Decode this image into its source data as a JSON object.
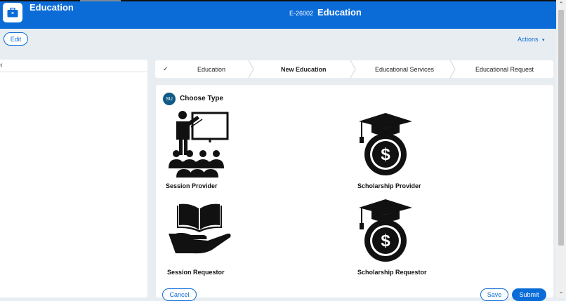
{
  "header": {
    "app_title": "Education",
    "case_id": "E-26002",
    "case_title": "Education"
  },
  "toolbar": {
    "edit_label": "Edit",
    "actions_label": "Actions",
    "actions_caret": "▾"
  },
  "left_panel": {
    "collapse_glyph": "‹"
  },
  "stepper": {
    "steps": [
      {
        "label": "Education",
        "state": "completed"
      },
      {
        "label": "New Education",
        "state": "current"
      },
      {
        "label": "Educational Services",
        "state": "pending"
      },
      {
        "label": "Educational Request",
        "state": "pending"
      }
    ],
    "check_glyph": "✓"
  },
  "form": {
    "avatar_initials": "SU",
    "title": "Choose Type",
    "options": [
      {
        "label": "Session Provider",
        "icon": "teacher-presentation-icon"
      },
      {
        "label": "Scholarship Provider",
        "icon": "graduation-cap-dollar-icon"
      },
      {
        "label": "Session Requestor",
        "icon": "hand-holding-book-icon"
      },
      {
        "label": "Scholarship Requestor",
        "icon": "graduation-cap-dollar-icon"
      }
    ]
  },
  "footer": {
    "cancel_label": "Cancel",
    "save_label": "Save",
    "submit_label": "Submit"
  },
  "colors": {
    "brand_blue": "#0b6cd8",
    "avatar_teal": "#0f5a86",
    "page_bg": "#e8edf2"
  }
}
